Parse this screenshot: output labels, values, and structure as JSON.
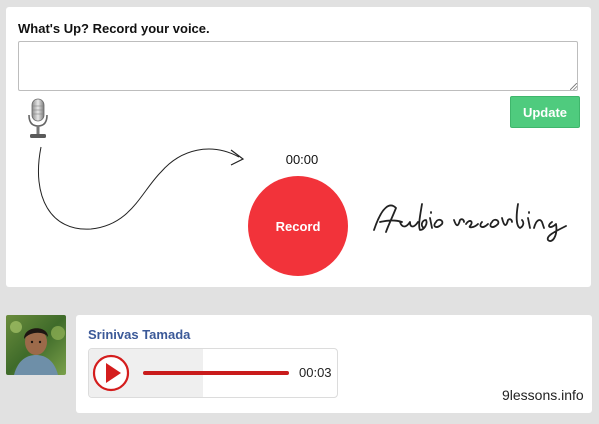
{
  "composer": {
    "title": "What's Up? Record your voice.",
    "textarea_value": "",
    "update_label": "Update"
  },
  "recorder": {
    "timer": "00:00",
    "record_label": "Record",
    "handwriting": "Audio recording"
  },
  "post": {
    "user_name": "Srinivas Tamada",
    "audio": {
      "duration": "00:03",
      "progress_fraction": 1.0
    }
  },
  "brand": "9lessons.info",
  "colors": {
    "record": "#f2333a",
    "update": "#4fcb7e",
    "user_link": "#3b5998",
    "play": "#d41d1d"
  },
  "icons": {
    "mic": "microphone-icon",
    "play": "play-icon"
  }
}
